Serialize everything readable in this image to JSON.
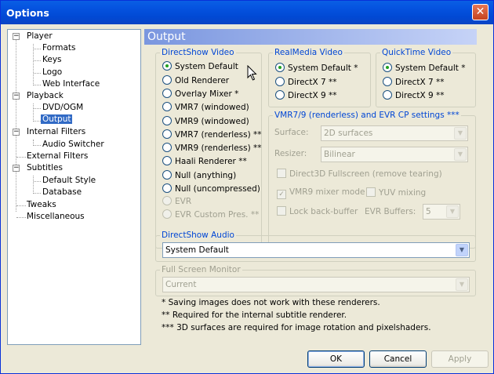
{
  "window": {
    "title": "Options",
    "close_icon": "close-icon"
  },
  "tree": [
    {
      "label": "Player",
      "expander": "−",
      "expanded": true
    },
    {
      "label": "Formats"
    },
    {
      "label": "Keys"
    },
    {
      "label": "Logo"
    },
    {
      "label": "Web Interface"
    },
    {
      "label": "Playback",
      "expander": "−",
      "expanded": true
    },
    {
      "label": "DVD/OGM"
    },
    {
      "label": "Output",
      "selected": true
    },
    {
      "label": "Internal Filters",
      "expander": "−",
      "expanded": true
    },
    {
      "label": "Audio Switcher"
    },
    {
      "label": "External Filters"
    },
    {
      "label": "Subtitles",
      "expander": "−",
      "expanded": true
    },
    {
      "label": "Default Style"
    },
    {
      "label": "Database"
    },
    {
      "label": "Tweaks"
    },
    {
      "label": "Miscellaneous"
    }
  ],
  "panel": {
    "header": "Output"
  },
  "directshow_video": {
    "label": "DirectShow Video",
    "options": [
      {
        "label": "System Default",
        "checked": true
      },
      {
        "label": "Old Renderer"
      },
      {
        "label": "Overlay Mixer *"
      },
      {
        "label": "VMR7 (windowed)"
      },
      {
        "label": "VMR9 (windowed)"
      },
      {
        "label": "VMR7 (renderless) **"
      },
      {
        "label": "VMR9 (renderless) **"
      },
      {
        "label": "Haali Renderer **"
      },
      {
        "label": "Null (anything)"
      },
      {
        "label": "Null (uncompressed)"
      },
      {
        "label": "EVR",
        "disabled": true
      },
      {
        "label": "EVR Custom Pres. **",
        "disabled": true
      }
    ]
  },
  "realmedia_video": {
    "label": "RealMedia Video",
    "options": [
      {
        "label": "System Default *",
        "checked": true
      },
      {
        "label": "DirectX 7 **"
      },
      {
        "label": "DirectX 9 **"
      }
    ]
  },
  "quicktime_video": {
    "label": "QuickTime Video",
    "options": [
      {
        "label": "System Default *",
        "checked": true
      },
      {
        "label": "DirectX 7 **"
      },
      {
        "label": "DirectX 9 **"
      }
    ]
  },
  "vmr_settings": {
    "label": "VMR7/9 (renderless) and EVR CP settings ***",
    "surface_label": "Surface:",
    "surface_value": "2D surfaces",
    "resizer_label": "Resizer:",
    "resizer_value": "Bilinear",
    "d3d_fullscreen": "Direct3D Fullscreen (remove tearing)",
    "vmr9_mixer": "VMR9 mixer mode",
    "vmr9_mixer_checked": true,
    "yuv_mixing": "YUV mixing",
    "lock_back_buffer": "Lock back-buffer",
    "evr_buffers_label": "EVR Buffers:",
    "evr_buffers_value": "5"
  },
  "directshow_audio": {
    "label": "DirectShow Audio",
    "value": "System Default"
  },
  "full_screen_monitor": {
    "label": "Full Screen Monitor",
    "value": "Current"
  },
  "notes": [
    "* Saving images does not work with these renderers.",
    "** Required for the internal subtitle renderer.",
    "*** 3D surfaces are required for image rotation and pixelshaders."
  ],
  "buttons": {
    "ok": "OK",
    "cancel": "Cancel",
    "apply": "Apply"
  },
  "colors": {
    "titlebar": "#0553e0",
    "selection": "#316ac5",
    "group_label": "#0046d5",
    "header_gradient_start": "#7a96df"
  }
}
